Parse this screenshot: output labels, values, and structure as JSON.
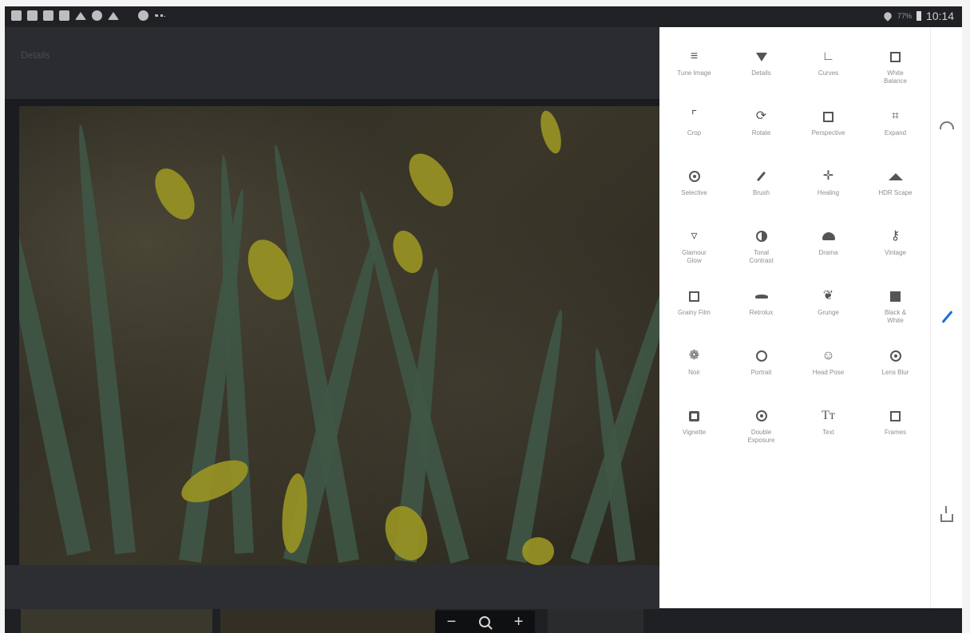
{
  "status_bar": {
    "battery_percent": "77%",
    "time": "10:14"
  },
  "app": {
    "title": "Details"
  },
  "tools": [
    {
      "label": "Tune Image",
      "icon": "sliders-icon"
    },
    {
      "label": "Details",
      "icon": "triangle-down-icon"
    },
    {
      "label": "Curves",
      "icon": "curves-icon"
    },
    {
      "label": "White\nBalance",
      "icon": "white-balance-icon"
    },
    {
      "label": "Crop",
      "icon": "crop-icon"
    },
    {
      "label": "Rotate",
      "icon": "rotate-icon"
    },
    {
      "label": "Perspective",
      "icon": "perspective-icon"
    },
    {
      "label": "Expand",
      "icon": "expand-icon"
    },
    {
      "label": "Selective",
      "icon": "selective-icon"
    },
    {
      "label": "Brush",
      "icon": "brush-icon"
    },
    {
      "label": "Healing",
      "icon": "healing-icon"
    },
    {
      "label": "HDR Scape",
      "icon": "mountain-icon"
    },
    {
      "label": "Glamour\nGlow",
      "icon": "glamour-glow-icon"
    },
    {
      "label": "Tonal\nContrast",
      "icon": "tonal-contrast-icon"
    },
    {
      "label": "Drama",
      "icon": "cloud-icon"
    },
    {
      "label": "Vintage",
      "icon": "lamp-icon"
    },
    {
      "label": "Grainy Film",
      "icon": "grainy-film-icon"
    },
    {
      "label": "Retrolux",
      "icon": "mustache-icon"
    },
    {
      "label": "Grunge",
      "icon": "grunge-icon"
    },
    {
      "label": "Black &\nWhite",
      "icon": "black-white-icon"
    },
    {
      "label": "Noir",
      "icon": "film-reel-icon"
    },
    {
      "label": "Portrait",
      "icon": "face-icon"
    },
    {
      "label": "Head Pose",
      "icon": "head-pose-icon"
    },
    {
      "label": "Lens Blur",
      "icon": "lens-blur-icon"
    },
    {
      "label": "Vignette",
      "icon": "vignette-icon"
    },
    {
      "label": "Double\nExposure",
      "icon": "double-exposure-icon"
    },
    {
      "label": "Text",
      "icon": "text-icon"
    },
    {
      "label": "Frames",
      "icon": "frames-icon"
    }
  ],
  "zoom": {
    "minus": "−",
    "plus": "+"
  },
  "colors": {
    "accent": "#1e6fd9",
    "panel_bg": "#ffffff",
    "photo_overlay": "#1a1c20"
  }
}
